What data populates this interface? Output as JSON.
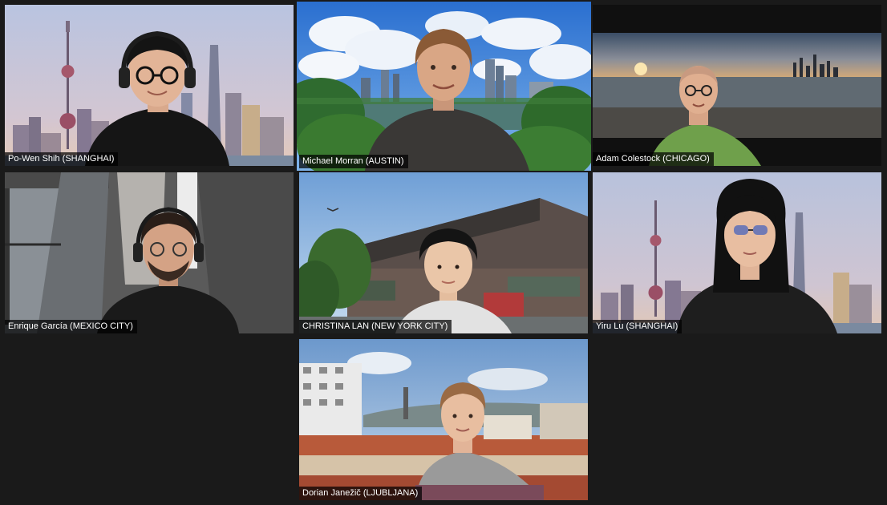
{
  "meeting": {
    "app": "Video conference gallery view",
    "participants": [
      {
        "name": "Po-Wen Shih (SHANGHAI)"
      },
      {
        "name": "Michael Morran (AUSTIN)"
      },
      {
        "name": "Adam Colestock (CHICAGO)"
      },
      {
        "name": "Enrique García (MEXICO CITY)"
      },
      {
        "name": "CHRISTINA LAN (NEW YORK CITY)"
      },
      {
        "name": "Yiru Lu (SHANGHAI)"
      },
      {
        "name": "Dorian Janežič (LJUBLJANA)"
      }
    ],
    "active_speaker_color": "#e9e39a",
    "background_color": "#1a1a1a"
  }
}
